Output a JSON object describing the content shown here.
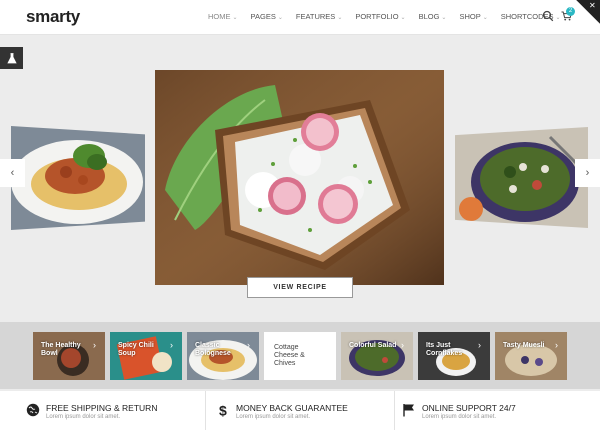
{
  "header": {
    "logo": "smarty",
    "nav": [
      {
        "label": "HOME",
        "active": true
      },
      {
        "label": "PAGES"
      },
      {
        "label": "FEATURES"
      },
      {
        "label": "PORTFOLIO"
      },
      {
        "label": "BLOG"
      },
      {
        "label": "SHOP"
      },
      {
        "label": "SHORTCODES"
      }
    ],
    "cart_count": "2"
  },
  "slider": {
    "button_label": "VIEW RECIPE",
    "prev_icon": "chevron-left-icon",
    "next_icon": "chevron-right-icon"
  },
  "thumbnails": [
    {
      "label": "The Healthy Bowl"
    },
    {
      "label": "Spicy Chili Soup"
    },
    {
      "label": "Classic Bolognese"
    },
    {
      "label": "Cottage Cheese & Chives",
      "active": true
    },
    {
      "label": "Colorful Salad"
    },
    {
      "label": "Its Just Cornflakes"
    },
    {
      "label": "Tasty Muesli"
    }
  ],
  "features": [
    {
      "title": "FREE SHIPPING & RETURN",
      "subtitle": "Lorem ipsum dolor sit amet.",
      "icon": "globe-icon"
    },
    {
      "title": "MONEY BACK GUARANTEE",
      "subtitle": "Lorem ipsum dolor sit amet.",
      "icon": "dollar-icon"
    },
    {
      "title": "ONLINE SUPPORT 24/7",
      "subtitle": "Lorem ipsum dolor sit amet.",
      "icon": "flag-icon"
    }
  ],
  "colors": {
    "accent": "#2bb8c4",
    "dark": "#222222"
  }
}
